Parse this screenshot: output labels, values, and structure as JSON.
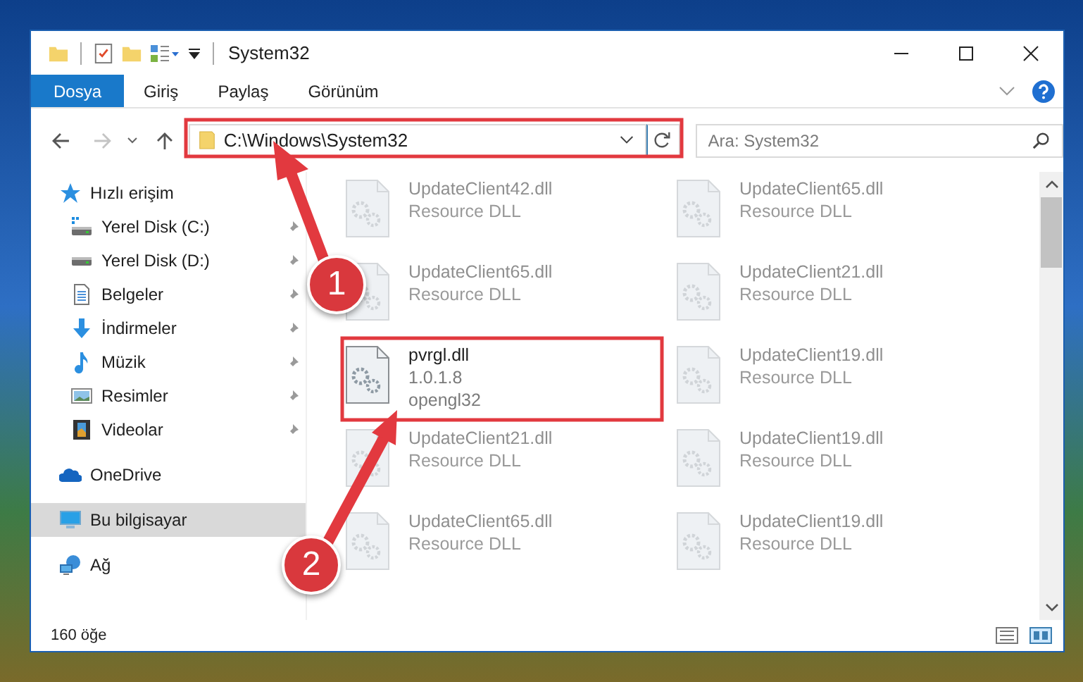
{
  "window": {
    "title": "System32"
  },
  "ribbon_tabs": [
    {
      "label": "Dosya",
      "selected": true
    },
    {
      "label": "Giriş",
      "selected": false
    },
    {
      "label": "Paylaş",
      "selected": false
    },
    {
      "label": "Görünüm",
      "selected": false
    }
  ],
  "navigation": {
    "back_disabled": false,
    "forward_disabled": true
  },
  "address": {
    "value": "C:\\Windows\\System32"
  },
  "search": {
    "placeholder": "Ara: System32"
  },
  "sidebar": {
    "items": [
      {
        "label": "Hızlı erişim",
        "kind": "star",
        "selected": false,
        "children": [
          {
            "label": "Yerel Disk (C:)",
            "kind": "system-drive",
            "pinned": true,
            "selected": false
          },
          {
            "label": "Yerel Disk (D:)",
            "kind": "drive",
            "pinned": true,
            "selected": false
          },
          {
            "label": "Belgeler",
            "kind": "document",
            "pinned": true,
            "selected": false
          },
          {
            "label": "İndirmeler",
            "kind": "download",
            "pinned": true,
            "selected": false
          },
          {
            "label": "Müzik",
            "kind": "music",
            "pinned": true,
            "selected": false
          },
          {
            "label": "Resimler",
            "kind": "picture",
            "pinned": true,
            "selected": false
          },
          {
            "label": "Videolar",
            "kind": "video",
            "pinned": true,
            "selected": false
          }
        ]
      },
      {
        "label": "OneDrive",
        "kind": "cloud",
        "selected": false
      },
      {
        "label": "Bu bilgisayar",
        "kind": "computer",
        "selected": true
      },
      {
        "label": "Ağ",
        "kind": "network",
        "selected": false
      }
    ]
  },
  "files": [
    {
      "name": "UpdateClient42.dll",
      "details": [
        "Resource DLL"
      ],
      "dimmed": true
    },
    {
      "name": "UpdateClient65.dll",
      "details": [
        "Resource DLL"
      ],
      "dimmed": true
    },
    {
      "name": "UpdateClient65.dll",
      "details": [
        "Resource DLL"
      ],
      "dimmed": true
    },
    {
      "name": "UpdateClient21.dll",
      "details": [
        "Resource DLL"
      ],
      "dimmed": true
    },
    {
      "name": "pvrgl.dll",
      "details": [
        "1.0.1.8",
        "opengl32"
      ],
      "dimmed": false
    },
    {
      "name": "UpdateClient19.dll",
      "details": [
        "Resource DLL"
      ],
      "dimmed": true
    },
    {
      "name": "UpdateClient21.dll",
      "details": [
        "Resource DLL"
      ],
      "dimmed": true
    },
    {
      "name": "UpdateClient19.dll",
      "details": [
        "Resource DLL"
      ],
      "dimmed": true
    },
    {
      "name": "UpdateClient65.dll",
      "details": [
        "Resource DLL"
      ],
      "dimmed": true
    },
    {
      "name": "UpdateClient19.dll",
      "details": [
        "Resource DLL"
      ],
      "dimmed": true
    }
  ],
  "status_bar": {
    "count": "160 öğe"
  },
  "annotations": [
    {
      "label": "1"
    },
    {
      "label": "2"
    }
  ]
}
